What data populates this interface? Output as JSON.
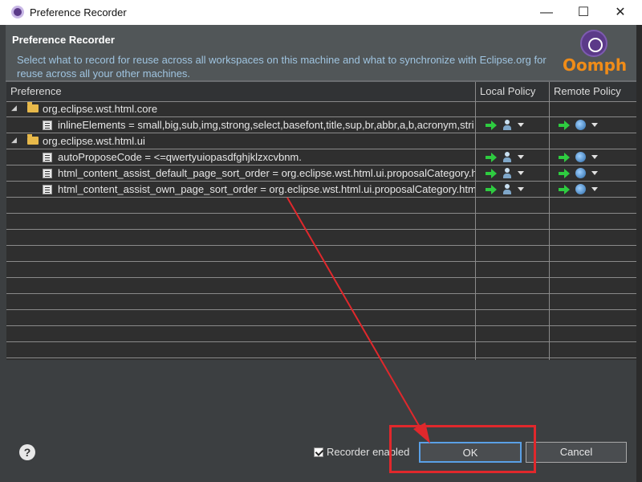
{
  "window": {
    "title": "Preference Recorder",
    "min_glyph": "—",
    "max_glyph": "☐",
    "close_glyph": "✕"
  },
  "header": {
    "title": "Preference Recorder",
    "description": "Select what to record for reuse across all workspaces on this machine and what to synchronize with Eclipse.org for reuse across all your other machines.",
    "logo_text": "Oomph"
  },
  "table": {
    "columns": [
      "Preference",
      "Local Policy",
      "Remote Policy"
    ],
    "groups": [
      {
        "name": "org.eclipse.wst.html.core",
        "expanded_glyph": "◢",
        "items": [
          {
            "text": "inlineElements = small,big,sub,img,strong,select,basefont,title,sup,br,abbr,a,b,acronym,stri"
          }
        ]
      },
      {
        "name": "org.eclipse.wst.html.ui",
        "expanded_glyph": "◢",
        "items": [
          {
            "text": "autoProposeCode = <=qwertyuiopasdfghjklzxcvbnm."
          },
          {
            "text": "html_content_assist_default_page_sort_order = org.eclipse.wst.html.ui.proposalCategory.ht"
          },
          {
            "text": "html_content_assist_own_page_sort_order = org.eclipse.wst.html.ui.proposalCategory.html"
          }
        ]
      }
    ]
  },
  "footer": {
    "help_glyph": "?",
    "recorder_enabled_label": "Recorder enabled",
    "recorder_enabled": true,
    "ok_label": "OK",
    "cancel_label": "Cancel"
  },
  "annotation_color": "#e0282c"
}
